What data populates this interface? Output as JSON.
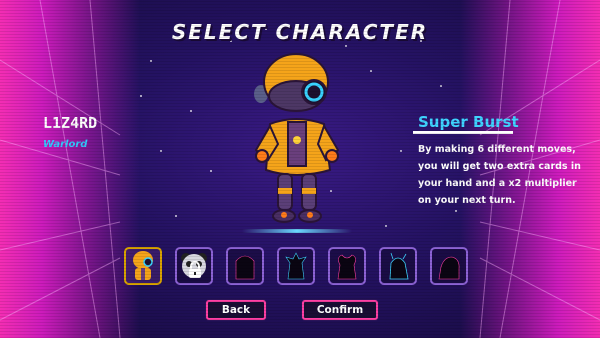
{
  "screen": {
    "title": "SELECT CHARACTER"
  },
  "character": {
    "name": "L1Z4RD",
    "class": "Warlord"
  },
  "ability": {
    "title": "Super Burst",
    "description_lines": [
      "By making 6 different moves,",
      "you will get two extra cards in",
      "your hand and a x2 multiplier",
      "on your next turn."
    ]
  },
  "roster": [
    {
      "id": "robot",
      "state": "selected"
    },
    {
      "id": "locked-panda",
      "state": "locked"
    },
    {
      "id": "silhouette-3",
      "state": "unknown"
    },
    {
      "id": "silhouette-4",
      "state": "unknown"
    },
    {
      "id": "silhouette-5",
      "state": "unknown"
    },
    {
      "id": "silhouette-6",
      "state": "unknown"
    },
    {
      "id": "silhouette-7",
      "state": "unknown"
    }
  ],
  "buttons": {
    "back": "Back",
    "confirm": "Confirm"
  },
  "colors": {
    "accent_cyan": "#3fd4ff",
    "accent_pink": "#ff3fa4",
    "selected_gold": "#d9a400",
    "background": "#241262"
  },
  "icons": {
    "lock": "lock-icon"
  }
}
